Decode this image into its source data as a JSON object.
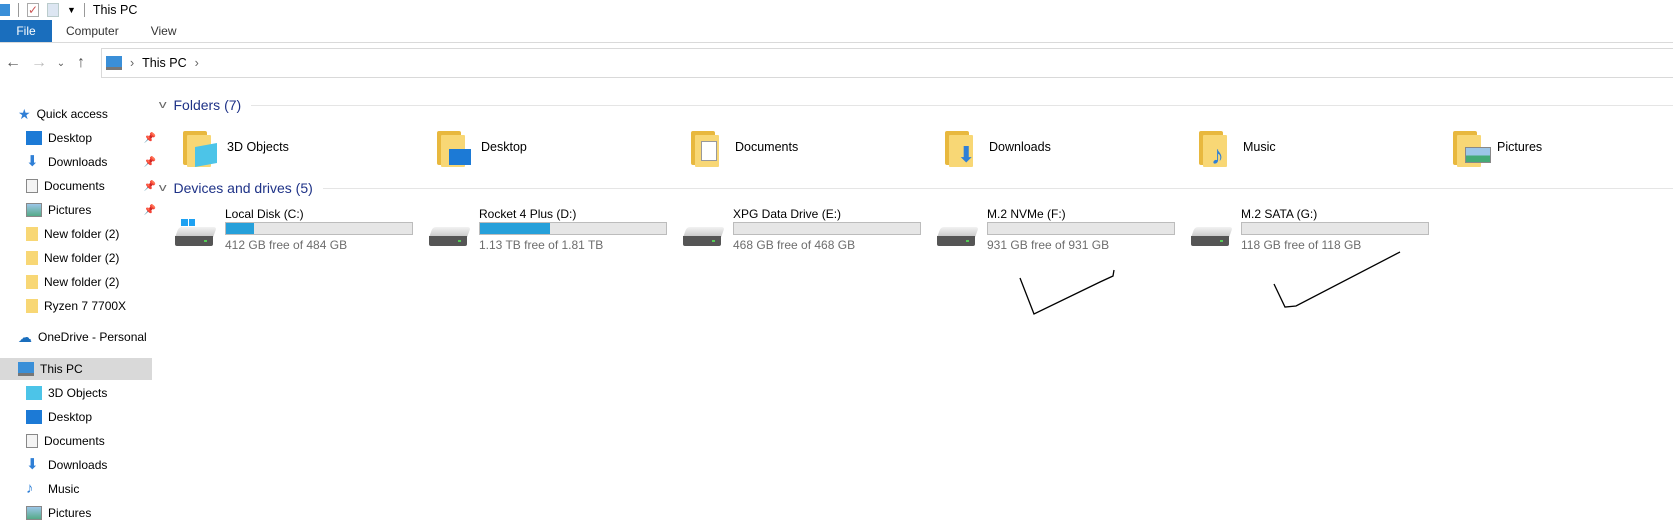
{
  "window": {
    "title": "This PC"
  },
  "ribbon": {
    "tabs": [
      "File",
      "Computer",
      "View"
    ]
  },
  "address": {
    "path": [
      "This PC"
    ]
  },
  "sidebar": {
    "quick_access": {
      "label": "Quick access",
      "items": [
        {
          "label": "Desktop",
          "icon": "desktop-icon",
          "pinned": true
        },
        {
          "label": "Downloads",
          "icon": "downloads-icon",
          "pinned": true
        },
        {
          "label": "Documents",
          "icon": "documents-icon",
          "pinned": true
        },
        {
          "label": "Pictures",
          "icon": "pictures-icon",
          "pinned": true
        },
        {
          "label": "New folder (2)",
          "icon": "folder-icon",
          "pinned": false
        },
        {
          "label": "New folder (2)",
          "icon": "folder-icon",
          "pinned": false
        },
        {
          "label": "New folder (2)",
          "icon": "folder-icon",
          "pinned": false
        },
        {
          "label": "Ryzen 7 7700X",
          "icon": "folder-icon",
          "pinned": false
        }
      ]
    },
    "onedrive": {
      "label": "OneDrive - Personal"
    },
    "this_pc": {
      "label": "This PC",
      "selected": true,
      "items": [
        {
          "label": "3D Objects"
        },
        {
          "label": "Desktop"
        },
        {
          "label": "Documents"
        },
        {
          "label": "Downloads"
        },
        {
          "label": "Music"
        },
        {
          "label": "Pictures"
        }
      ]
    }
  },
  "main": {
    "folders_header": "Folders (7)",
    "folders": [
      {
        "label": "3D Objects"
      },
      {
        "label": "Desktop"
      },
      {
        "label": "Documents"
      },
      {
        "label": "Downloads"
      },
      {
        "label": "Music"
      },
      {
        "label": "Pictures"
      }
    ],
    "drives_header": "Devices and drives (5)",
    "drives": [
      {
        "name": "Local Disk (C:)",
        "free": "412 GB free of 484 GB",
        "used_fraction": 0.149,
        "windows": true
      },
      {
        "name": "Rocket 4 Plus (D:)",
        "free": "1.13 TB free of 1.81 TB",
        "used_fraction": 0.376
      },
      {
        "name": "XPG Data Drive (E:)",
        "free": "468 GB free of 468 GB",
        "used_fraction": 0
      },
      {
        "name": "M.2 NVMe (F:)",
        "free": "931 GB free of 931 GB",
        "used_fraction": 0
      },
      {
        "name": "M.2 SATA (G:)",
        "free": "118 GB free of 118 GB",
        "used_fraction": 0
      }
    ]
  },
  "colors": {
    "accent": "#1a6ebd",
    "bar_fill": "#26a0da",
    "group_header": "#1e3287"
  }
}
